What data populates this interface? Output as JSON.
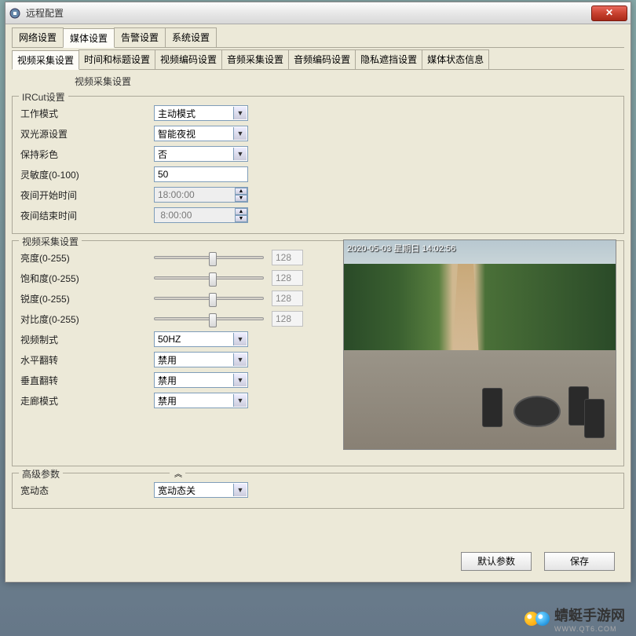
{
  "window": {
    "title": "远程配置"
  },
  "tabs_main": [
    {
      "label": "网络设置",
      "active": false
    },
    {
      "label": "媒体设置",
      "active": true
    },
    {
      "label": "告警设置",
      "active": false
    },
    {
      "label": "系统设置",
      "active": false
    }
  ],
  "tabs_sub": [
    {
      "label": "视频采集设置",
      "active": true
    },
    {
      "label": "时间和标题设置",
      "active": false
    },
    {
      "label": "视频编码设置",
      "active": false
    },
    {
      "label": "音频采集设置",
      "active": false
    },
    {
      "label": "音频编码设置",
      "active": false
    },
    {
      "label": "隐私遮挡设置",
      "active": false
    },
    {
      "label": "媒体状态信息",
      "active": false
    }
  ],
  "subtitle": "视频采集设置",
  "ircut": {
    "group_title": "IRCut设置",
    "work_mode": {
      "label": "工作模式",
      "value": "主动模式"
    },
    "dual_light": {
      "label": "双光源设置",
      "value": "智能夜视"
    },
    "keep_color": {
      "label": "保持彩色",
      "value": "否"
    },
    "sensitivity": {
      "label": "灵敏度(0-100)",
      "value": "50"
    },
    "night_start": {
      "label": "夜间开始时间",
      "value": "18:00:00"
    },
    "night_end": {
      "label": "夜间结束时间",
      "value": " 8:00:00"
    }
  },
  "capture": {
    "group_title": "视频采集设置",
    "brightness": {
      "label": "亮度(0-255)",
      "value": "128",
      "pos": 50
    },
    "saturation": {
      "label": "饱和度(0-255)",
      "value": "128",
      "pos": 50
    },
    "sharpness": {
      "label": "锐度(0-255)",
      "value": "128",
      "pos": 50
    },
    "contrast": {
      "label": "对比度(0-255)",
      "value": "128",
      "pos": 50
    },
    "standard": {
      "label": "视频制式",
      "value": "50HZ"
    },
    "hflip": {
      "label": "水平翻转",
      "value": "禁用"
    },
    "vflip": {
      "label": "垂直翻转",
      "value": "禁用"
    },
    "corridor": {
      "label": "走廊模式",
      "value": "禁用"
    }
  },
  "advanced": {
    "group_title": "高级参数",
    "collapse_glyph": "︽",
    "wdr": {
      "label": "宽动态",
      "value": "宽动态关"
    }
  },
  "preview": {
    "osd_text": "2020-05-03 星期日 14:02:56"
  },
  "footer": {
    "defaults": "默认参数",
    "save": "保存"
  },
  "watermark": {
    "text": "蜻蜓手游网",
    "sub": "WWW.QT6.COM"
  }
}
